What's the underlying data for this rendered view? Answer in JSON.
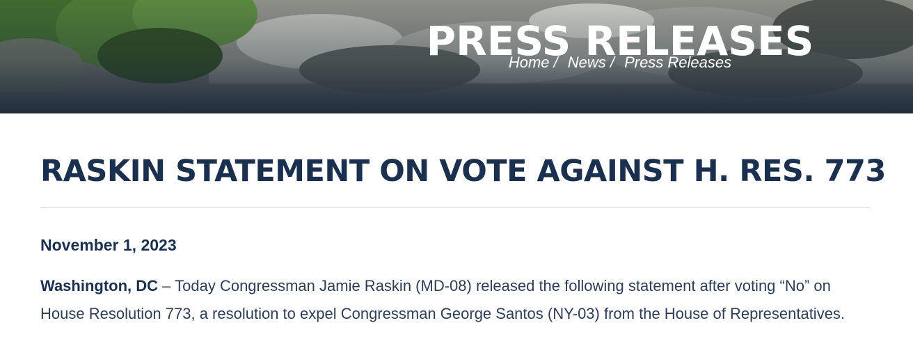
{
  "hero": {
    "title": "PRESS RELEASES",
    "breadcrumb": [
      {
        "label": "Home"
      },
      {
        "label": "News"
      },
      {
        "label": "Press Releases"
      }
    ],
    "separator": "/"
  },
  "article": {
    "title": "RASKIN STATEMENT ON VOTE AGAINST H. RES. 773",
    "date": "November 1, 2023",
    "dateline": "Washington, DC",
    "body": " – Today Congressman Jamie Raskin (MD-08) released the following statement after voting “No” on House Resolution 773, a resolution to expel Congressman George Santos (NY-03) from the House of Representatives."
  },
  "colors": {
    "title": "#1b2f4f",
    "text": "#2f3d55",
    "hero_overlay": "#1e2a3a"
  }
}
